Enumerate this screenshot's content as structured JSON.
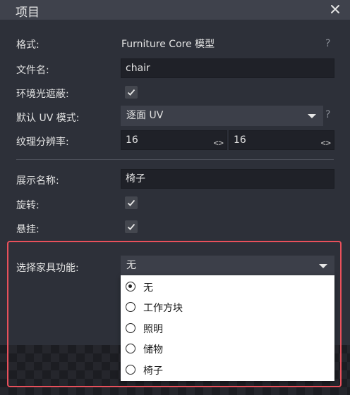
{
  "dialog": {
    "title": "项目",
    "close_icon": "close-icon"
  },
  "format": {
    "label": "格式:",
    "value": "Furniture Core 模型",
    "help": "?"
  },
  "filename": {
    "label": "文件名:",
    "value": "chair"
  },
  "ambient_occlusion": {
    "label": "环境光遮蔽:",
    "checked": true
  },
  "uv_mode": {
    "label": "默认 UV 模式:",
    "value": "逐面 UV",
    "help": "?"
  },
  "texture_resolution": {
    "label": "纹理分辨率:",
    "width": "16",
    "height": "16",
    "stepper_icon": "<>"
  },
  "display_name": {
    "label": "展示名称:",
    "value": "椅子"
  },
  "rotatable": {
    "label": "旋转:",
    "checked": true
  },
  "hangable": {
    "label": "悬挂:",
    "checked": true
  },
  "furniture_function": {
    "label": "选择家具功能:",
    "value": "无",
    "options": [
      {
        "label": "无",
        "selected": true
      },
      {
        "label": "工作方块",
        "selected": false
      },
      {
        "label": "照明",
        "selected": false
      },
      {
        "label": "储物",
        "selected": false
      },
      {
        "label": "椅子",
        "selected": false
      }
    ]
  },
  "colors": {
    "highlight": "#e8505b",
    "titlebar": "#3f424c",
    "background": "#2d3039"
  }
}
